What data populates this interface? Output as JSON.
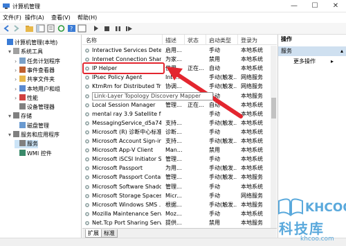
{
  "window": {
    "title": "计算机管理",
    "minimize": "—",
    "maximize": "☐",
    "close": "✕"
  },
  "menu": [
    "文件(F)",
    "操作(A)",
    "查看(V)",
    "帮助(H)"
  ],
  "tree": [
    {
      "label": "计算机管理(本地)",
      "indent": 0,
      "arrow": ""
    },
    {
      "label": "系统工具",
      "indent": 1,
      "arrow": "▾"
    },
    {
      "label": "任务计划程序",
      "indent": 2,
      "arrow": "›"
    },
    {
      "label": "事件查看器",
      "indent": 2,
      "arrow": "›"
    },
    {
      "label": "共享文件夹",
      "indent": 2,
      "arrow": "›"
    },
    {
      "label": "本地用户和组",
      "indent": 2,
      "arrow": "›"
    },
    {
      "label": "性能",
      "indent": 2,
      "arrow": "›"
    },
    {
      "label": "设备管理器",
      "indent": 2,
      "arrow": ""
    },
    {
      "label": "存储",
      "indent": 1,
      "arrow": "▾"
    },
    {
      "label": "磁盘管理",
      "indent": 2,
      "arrow": ""
    },
    {
      "label": "服务和应用程序",
      "indent": 1,
      "arrow": "▾"
    },
    {
      "label": "服务",
      "indent": 2,
      "arrow": "",
      "selected": true
    },
    {
      "label": "WMI 控件",
      "indent": 2,
      "arrow": ""
    }
  ],
  "columns": [
    "名称",
    "描述",
    "状态",
    "启动类型",
    "登录为"
  ],
  "rows": [
    {
      "name": "Interactive Services Detect...",
      "desc": "启用...",
      "status": "",
      "startup": "手动",
      "logon": "本地系统"
    },
    {
      "name": "Internet Connection Sharin...",
      "desc": "为家...",
      "status": "",
      "startup": "禁用",
      "logon": "本地系统"
    },
    {
      "name": "IP Helper",
      "desc": "使用...",
      "status": "正在...",
      "startup": "自动",
      "logon": "本地系统"
    },
    {
      "name": "IPsec Policy Agent",
      "desc": "Inte...",
      "status": "",
      "startup": "手动(触发...",
      "logon": "网络服务"
    },
    {
      "name": "KtmRm for Distributed Tra...",
      "desc": "协调...",
      "status": "",
      "startup": "手动(触发...",
      "logon": "网络服务"
    },
    {
      "name": "Link-Layer Topology Discovery Mapper",
      "desc": "",
      "status": "",
      "startup": "手动",
      "logon": "本地服务"
    },
    {
      "name": "Local Session Manager",
      "desc": "管理...",
      "status": "正在...",
      "startup": "自动",
      "logon": "本地系统"
    },
    {
      "name": "mental ray 3.9 Satellite for...",
      "desc": "",
      "status": "",
      "startup": "手动",
      "logon": "本地系统"
    },
    {
      "name": "MessagingService_d5a74",
      "desc": "支持...",
      "status": "",
      "startup": "手动(触发...",
      "logon": "本地系统"
    },
    {
      "name": "Microsoft (R) 诊断中心标准...",
      "desc": "诊断...",
      "status": "",
      "startup": "手动",
      "logon": "本地系统"
    },
    {
      "name": "Microsoft Account Sign-in ...",
      "desc": "支持...",
      "status": "",
      "startup": "手动(触发...",
      "logon": "本地系统"
    },
    {
      "name": "Microsoft App-V Client",
      "desc": "Man...",
      "status": "",
      "startup": "禁用",
      "logon": "本地系统"
    },
    {
      "name": "Microsoft iSCSI Initiator S...",
      "desc": "管理...",
      "status": "",
      "startup": "手动",
      "logon": "本地系统"
    },
    {
      "name": "Microsoft Passport",
      "desc": "为用...",
      "status": "",
      "startup": "手动(触发...",
      "logon": "本地系统"
    },
    {
      "name": "Microsoft Passport Contai...",
      "desc": "管理...",
      "status": "",
      "startup": "手动(触发...",
      "logon": "本地服务"
    },
    {
      "name": "Microsoft Software Shado...",
      "desc": "管理...",
      "status": "",
      "startup": "手动",
      "logon": "本地系统"
    },
    {
      "name": "Microsoft Storage Spaces...",
      "desc": "Micr...",
      "status": "",
      "startup": "手动",
      "logon": "网络服务"
    },
    {
      "name": "Microsoft Windows SMS ...",
      "desc": "根据...",
      "status": "",
      "startup": "手动(触发...",
      "logon": "本地服务"
    },
    {
      "name": "Mozilla Maintenance Servi...",
      "desc": "Moz...",
      "status": "",
      "startup": "手动",
      "logon": "本地系统"
    },
    {
      "name": "Net.Tcp Port Sharing Servi...",
      "desc": "提供...",
      "status": "",
      "startup": "禁用",
      "logon": "本地服务"
    }
  ],
  "tabs": [
    "扩展",
    "标准"
  ],
  "actions": {
    "header": "操作",
    "section": "服务",
    "section_arrow": "▴",
    "more": "更多操作",
    "more_arrow": "▸"
  },
  "watermark": {
    "brand": "KHCOO",
    "cn": "科技库",
    "url": "khcoo.com"
  },
  "colors": {
    "highlight_box": "#e3262f",
    "arrow": "#e3262f",
    "selection": "#cce4f7",
    "action_section": "#cfe0f0",
    "watermark": "#5aa9dc"
  }
}
